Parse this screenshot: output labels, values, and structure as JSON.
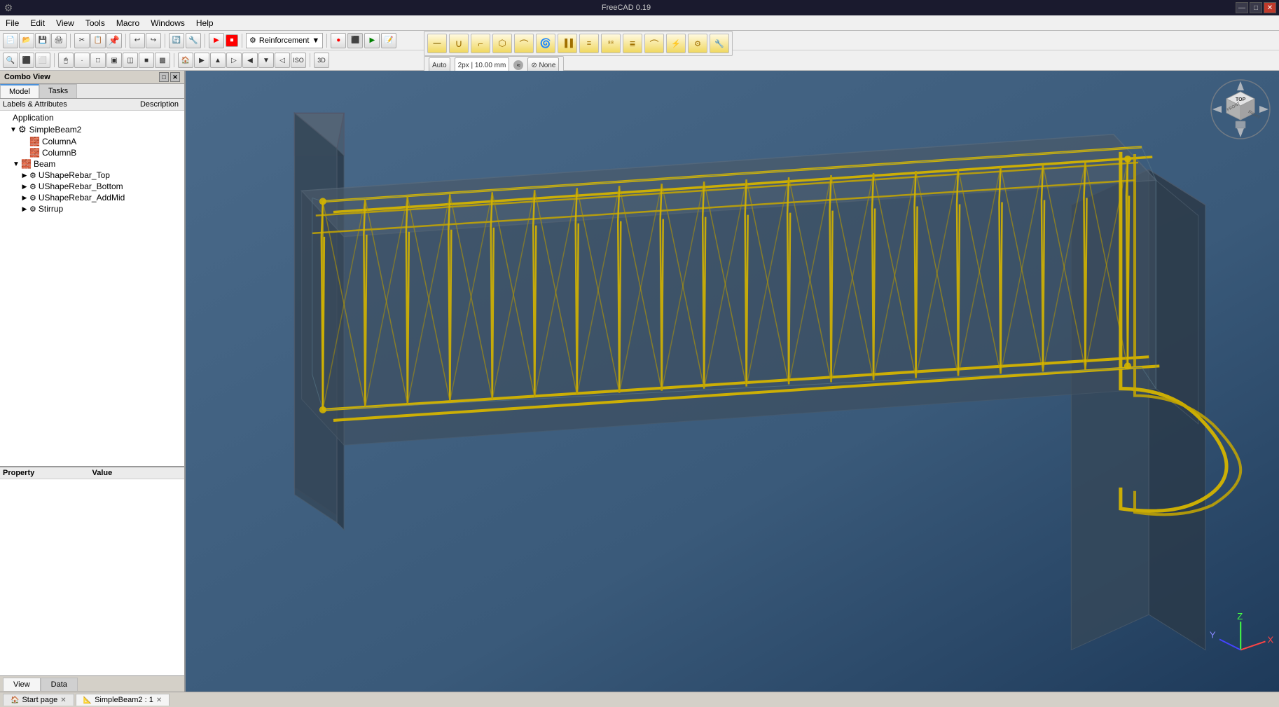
{
  "titlebar": {
    "title": "FreeCAD 0.19",
    "minimize_label": "—",
    "maximize_label": "□",
    "close_label": "✕"
  },
  "menubar": {
    "items": [
      "File",
      "Edit",
      "View",
      "Tools",
      "Macro",
      "Windows",
      "Help"
    ]
  },
  "toolbar1": {
    "workbench": "Reinforcement",
    "buttons": [
      "📄",
      "📂",
      "💾",
      "🖨",
      "✂",
      "📋",
      "📌",
      "↩",
      "↪",
      "🔄",
      "🔧",
      "▶",
      "⏹",
      "💡"
    ]
  },
  "toolbar2": {
    "buttons": [
      "🔍",
      "🔲",
      "⬛",
      "⬜",
      "🖱",
      "📐",
      "📏",
      "🔲",
      "🔳",
      "🔲",
      "🔳",
      "🔲",
      "🔳",
      "🔲",
      "🔳",
      "🔲",
      "🖊"
    ]
  },
  "reinforcement_toolbar": {
    "tools": [
      "—",
      "∪",
      "⌒",
      "⬡",
      "⌒",
      "⭕",
      "▐▐",
      "≡",
      "⁸",
      "≣",
      "⌒",
      "⚡",
      "⚙",
      "🔧"
    ]
  },
  "snap_bar": {
    "auto": "Auto",
    "px_label": "2px | 10.00 mm",
    "none_label": "⊘ None"
  },
  "combo_view": {
    "title": "Combo View"
  },
  "model_tabs": [
    {
      "label": "Model",
      "active": true
    },
    {
      "label": "Tasks",
      "active": false
    }
  ],
  "labels_row": {
    "labels": "Labels & Attributes",
    "description": "Description"
  },
  "tree": {
    "items": [
      {
        "id": "app",
        "label": "Application",
        "level": 0,
        "toggle": "",
        "icon": "",
        "is_root": true
      },
      {
        "id": "simplebeam2",
        "label": "SimpleBeam2",
        "level": 1,
        "toggle": "▼",
        "icon": "⚙",
        "selected": false
      },
      {
        "id": "columnA",
        "label": "ColumnA",
        "level": 2,
        "toggle": "",
        "icon": "🧱",
        "selected": false
      },
      {
        "id": "columnB",
        "label": "ColumnB",
        "level": 2,
        "toggle": "",
        "icon": "🧱",
        "selected": false
      },
      {
        "id": "beam",
        "label": "Beam",
        "level": 1,
        "toggle": "▼",
        "icon": "🧱",
        "selected": false,
        "parent_expanded": true
      },
      {
        "id": "ushaperebar_top",
        "label": "UShapeRebar_Top",
        "level": 2,
        "toggle": "▶",
        "icon": "⚙",
        "selected": false
      },
      {
        "id": "ushaperebar_bottom",
        "label": "UShapeRebar_Bottom",
        "level": 2,
        "toggle": "▶",
        "icon": "⚙",
        "selected": false
      },
      {
        "id": "ushaperebar_addmid",
        "label": "UShapeRebar_AddMid",
        "level": 2,
        "toggle": "▶",
        "icon": "⚙",
        "selected": false
      },
      {
        "id": "stirrup",
        "label": "Stirrup",
        "level": 2,
        "toggle": "▶",
        "icon": "⚙",
        "selected": false
      }
    ]
  },
  "property_panel": {
    "property_label": "Property",
    "value_label": "Value"
  },
  "bottom_tabs": [
    {
      "label": "Start page",
      "active": false,
      "closable": true,
      "icon": "🏠"
    },
    {
      "label": "SimpleBeam2 : 1",
      "active": true,
      "closable": true,
      "icon": "📐"
    }
  ],
  "view_data_tabs": [
    {
      "label": "View",
      "active": true
    },
    {
      "label": "Data",
      "active": false
    }
  ],
  "viewport": {
    "background_top": "#4a6a8a",
    "background_bottom": "#1e3a5a"
  }
}
